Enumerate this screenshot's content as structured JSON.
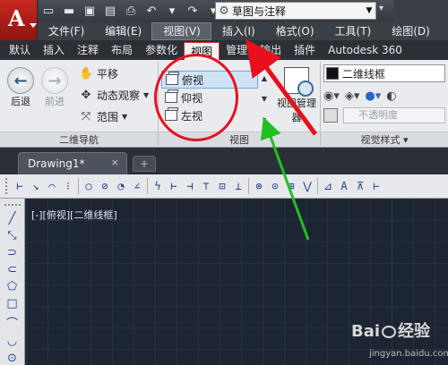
{
  "app": {
    "logo": "A"
  },
  "quick_access": [
    {
      "icon": "new-icon",
      "glyph": "▭"
    },
    {
      "icon": "open-icon",
      "glyph": "▬"
    },
    {
      "icon": "save-icon",
      "glyph": "▣"
    },
    {
      "icon": "saveas-icon",
      "glyph": "▤"
    },
    {
      "icon": "print-icon",
      "glyph": "⎙"
    },
    {
      "icon": "undo-icon",
      "glyph": "↶"
    },
    {
      "icon": "undo-dropdown-icon",
      "glyph": "▾"
    },
    {
      "icon": "redo-icon",
      "glyph": "↷"
    },
    {
      "icon": "redo-dropdown-icon",
      "glyph": "▾"
    }
  ],
  "workspace": {
    "label": "草图与注释"
  },
  "menu": [
    "文件(F)",
    "编辑(E)",
    "视图(V)",
    "插入(I)",
    "格式(O)",
    "工具(T)",
    "绘图(D)"
  ],
  "menu_active": 2,
  "tabs": [
    "默认",
    "插入",
    "注释",
    "布局",
    "参数化",
    "视图",
    "管理",
    "输出",
    "插件",
    "Autodesk 360"
  ],
  "tab_active": 5,
  "nav2d": {
    "back": "后退",
    "forward": "前进",
    "pan": "平移",
    "orbit": "动态观察",
    "extents": "范围",
    "title": "二维导航"
  },
  "views": {
    "items": [
      "俯视",
      "仰视",
      "左视"
    ],
    "selected": 0,
    "title": "视图",
    "manager": "视图管理器"
  },
  "visual_styles": {
    "current": "二维线框",
    "opacity_placeholder": "不透明度",
    "title": "视觉样式"
  },
  "document": {
    "tab": "Drawing1*",
    "close": "×",
    "new_tab": "+"
  },
  "dim_toolbar": [
    "⊢",
    "↘",
    "⌒",
    "⁝",
    "○",
    "⊘",
    "◔",
    "∠",
    "ϟ",
    "⊢",
    "⊣",
    "⊤",
    "⊡",
    "⊥",
    "⊕",
    "⊙",
    "⊞",
    "⋁",
    "⊿",
    "A",
    "⊼",
    "⊢"
  ],
  "palette": [
    "╱",
    "⤡",
    "⊃",
    "⊂",
    "⬠",
    "□",
    "⌒",
    "◡",
    "⊙"
  ],
  "viewport": {
    "label": "[-][俯视][二维线框]"
  },
  "watermark": {
    "brand": "Bai  经验",
    "url": "jingyan.baidu.com"
  }
}
